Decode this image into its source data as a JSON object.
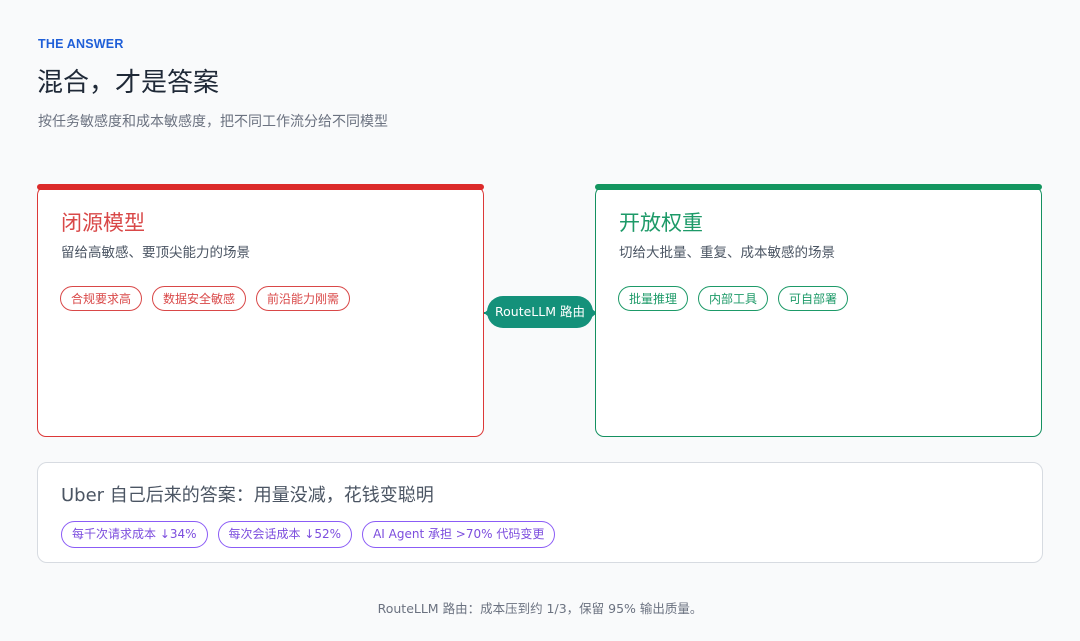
{
  "header": {
    "eyebrow": "THE ANSWER",
    "title": "混合，才是答案",
    "subtitle": "按任务敏感度和成本敏感度，把不同工作流分给不同模型"
  },
  "closed_card": {
    "title": "闭源模型",
    "description": "留给高敏感、要顶尖能力的场景",
    "tags": [
      "合规要求高",
      "数据安全敏感",
      "前沿能力刚需"
    ],
    "accent_color": "#dc3838"
  },
  "router": {
    "label": "RouteLLM 路由",
    "color": "#14917a"
  },
  "open_card": {
    "title": "开放权重",
    "description": "切给大批量、重复、成本敏感的场景",
    "tags": [
      "批量推理",
      "内部工具",
      "可自部署"
    ],
    "accent_color": "#149060"
  },
  "uber": {
    "title": "Uber 自己后来的答案：用量没减，花钱变聪明",
    "tags": [
      "每千次请求成本 ↓34%",
      "每次会话成本 ↓52%",
      "AI Agent 承担 >70% 代码变更"
    ],
    "accent_color": "#8b5cf6"
  },
  "footer": {
    "text": "RouteLLM 路由：成本压到约 1/3，保留 95% 输出质量。"
  }
}
